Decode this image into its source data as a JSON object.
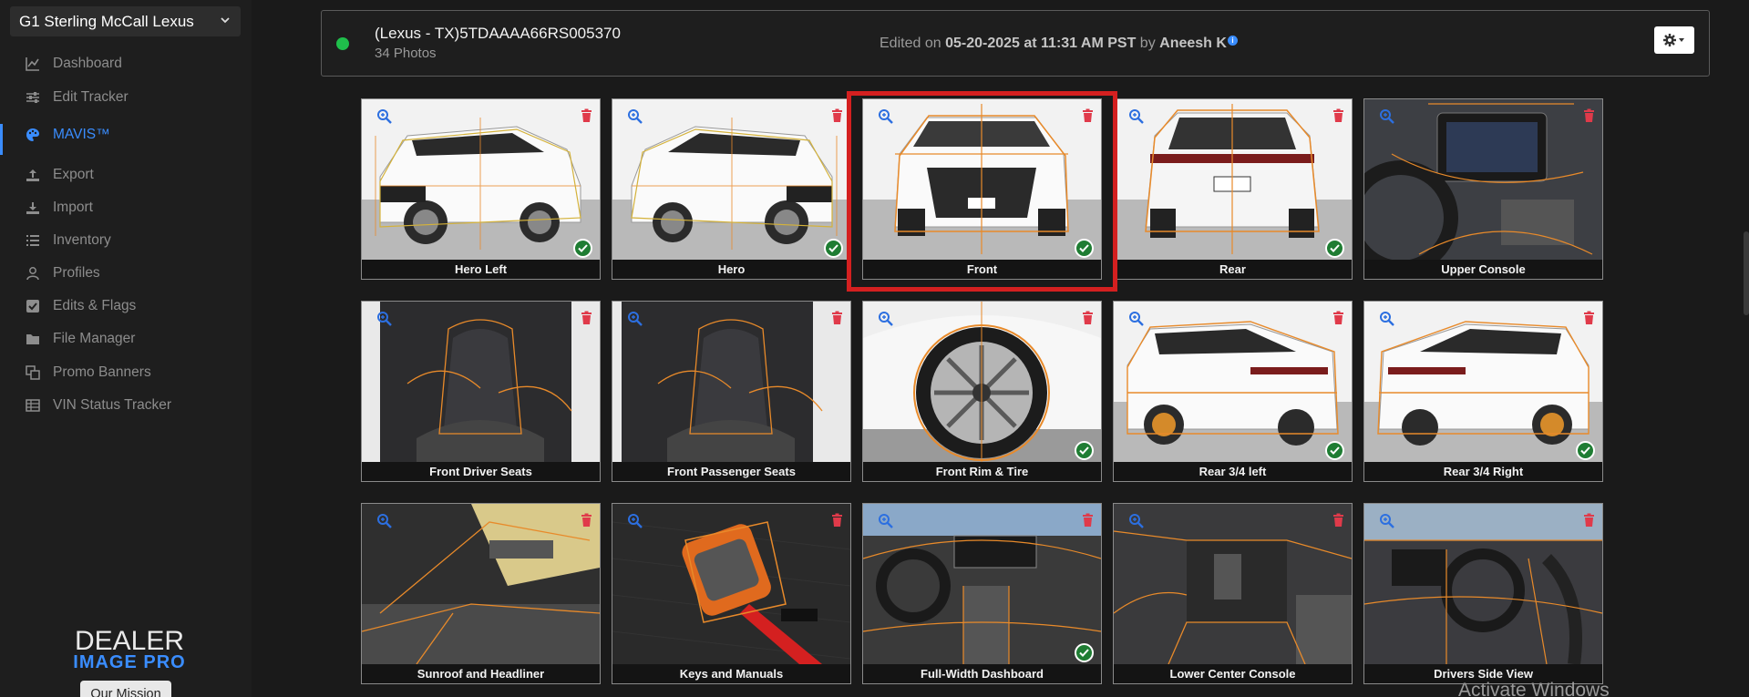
{
  "sidebar": {
    "dealer": "G1 Sterling McCall Lexus",
    "items": [
      {
        "label": "Dashboard",
        "icon": "chart-icon"
      },
      {
        "label": "Edit Tracker",
        "icon": "sliders-icon"
      },
      {
        "label": "MAVIS™",
        "icon": "palette-icon",
        "active": true
      },
      {
        "label": "Export",
        "icon": "upload-icon"
      },
      {
        "label": "Import",
        "icon": "download-icon"
      },
      {
        "label": "Inventory",
        "icon": "list-icon"
      },
      {
        "label": "Profiles",
        "icon": "user-icon"
      },
      {
        "label": "Edits & Flags",
        "icon": "check-square-icon"
      },
      {
        "label": "File Manager",
        "icon": "folder-icon"
      },
      {
        "label": "Promo Banners",
        "icon": "banners-icon"
      },
      {
        "label": "VIN Status Tracker",
        "icon": "table-icon"
      }
    ],
    "logo_top": "DEALER",
    "logo_bottom": "IMAGE PRO",
    "mission_button": "Our Mission"
  },
  "header": {
    "vin_title": "(Lexus - TX)5TDAAAA66RS005370",
    "photo_count": "34 Photos",
    "edited_prefix": "Edited on ",
    "edited_date": "05-20-2025 at 11:31 AM PST",
    "edited_by_prefix": " by ",
    "edited_by": "Aneesh K",
    "status_color": "#1fbf4b"
  },
  "tiles": [
    {
      "label": "Hero Left",
      "checked": true
    },
    {
      "label": "Hero",
      "checked": true
    },
    {
      "label": "Front",
      "checked": true,
      "highlighted": true
    },
    {
      "label": "Rear",
      "checked": true
    },
    {
      "label": "Upper Console",
      "checked": false
    },
    {
      "label": "Front Driver Seats",
      "checked": false
    },
    {
      "label": "Front Passenger Seats",
      "checked": false
    },
    {
      "label": "Front Rim & Tire",
      "checked": true
    },
    {
      "label": "Rear 3/4 left",
      "checked": true
    },
    {
      "label": "Rear 3/4 Right",
      "checked": true
    },
    {
      "label": "Sunroof and Headliner",
      "checked": false
    },
    {
      "label": "Keys and Manuals",
      "checked": false
    },
    {
      "label": "Full-Width Dashboard",
      "checked": true
    },
    {
      "label": "Lower Center Console",
      "checked": false
    },
    {
      "label": "Drivers Side View",
      "checked": false
    }
  ],
  "watermark": "Activate Windows",
  "colors": {
    "accent": "#3a8dff",
    "highlight": "#d42020",
    "overlay": "#e88a2a",
    "check": "#1f7d33"
  }
}
